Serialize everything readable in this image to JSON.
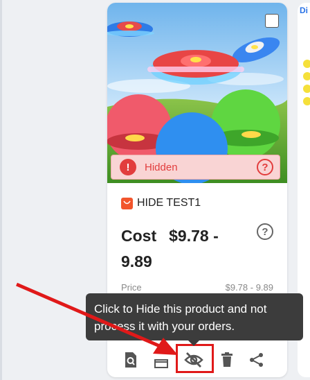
{
  "card": {
    "image_alt": "flying saucer balls product photo",
    "status_label": "Hidden",
    "store_name": "HIDE TEST1",
    "cost_label": "Cost",
    "cost_value": "$9.78 - 9.89",
    "price_label": "Price",
    "price_value": "$9.78 - 9.89"
  },
  "actions": [
    {
      "name": "details-button",
      "icon": "search-document-icon"
    },
    {
      "name": "edit-button",
      "icon": "box-icon"
    },
    {
      "name": "hide-button",
      "icon": "eye-slash-icon"
    },
    {
      "name": "delete-button",
      "icon": "trash-icon"
    },
    {
      "name": "share-button",
      "icon": "share-icon"
    }
  ],
  "tooltip": {
    "text": "Click to Hide this product and not process it with your orders."
  },
  "right_card": {
    "logo_text": "Di"
  },
  "colors": {
    "hidden_red": "#e23d3d",
    "highlight_red": "#e01919",
    "tooltip_bg": "#3c3c3c",
    "store_orange": "#f2552c"
  }
}
